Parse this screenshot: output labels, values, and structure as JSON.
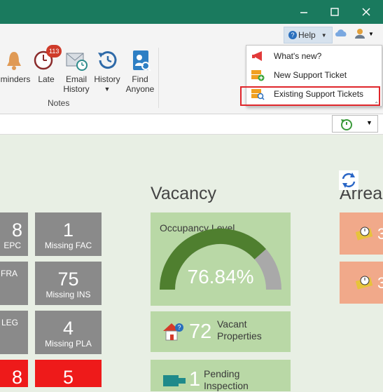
{
  "window": {
    "minimize_icon": "minimize-icon",
    "maximize_icon": "maximize-icon",
    "close_icon": "close-icon"
  },
  "ribbon": {
    "buttons": {
      "reminders": "minders",
      "late": "Late",
      "late_badge": "113",
      "email_history_1": "Email",
      "email_history_2": "History",
      "history": "History",
      "find_anyone_1": "Find",
      "find_anyone_2": "Anyone"
    },
    "group_label": "Notes"
  },
  "help": {
    "label": "Help",
    "badge": "?"
  },
  "help_menu": {
    "items": [
      {
        "label": "What's new?",
        "icon": "megaphone-icon"
      },
      {
        "label": "New Support Ticket",
        "icon": "new-ticket-icon"
      },
      {
        "label": "Existing Support Tickets",
        "icon": "search-ticket-icon"
      }
    ]
  },
  "dashboard": {
    "vacancy_title": "Vacancy",
    "arrears_title": "Arrea",
    "tiles": [
      {
        "num": "8",
        "label": "EPC",
        "color": "grey"
      },
      {
        "num": "1",
        "label": "Missing FAC",
        "color": "grey"
      },
      {
        "num": "",
        "label": "FRA",
        "color": "grey"
      },
      {
        "num": "75",
        "label": "Missing INS",
        "color": "grey"
      },
      {
        "num": "",
        "label": "LEG",
        "color": "grey"
      },
      {
        "num": "4",
        "label": "Missing PLA",
        "color": "grey"
      },
      {
        "num": "8",
        "label": "",
        "color": "red"
      },
      {
        "num": "5",
        "label": "",
        "color": "red"
      }
    ],
    "occupancy": {
      "title": "Occupancy Level",
      "value": "76.84%",
      "percent": 76.84
    },
    "vacant": {
      "num": "72",
      "label_1": "Vacant",
      "label_2": "Properties"
    },
    "pending": {
      "num": "1",
      "label_1": "Pending",
      "label_2": "Inspection"
    },
    "arrears_values": [
      "3",
      "3"
    ]
  },
  "colors": {
    "titlebar": "#1a7a5e",
    "accent_green": "#4f7f2f",
    "highlight": "#e0262b"
  }
}
